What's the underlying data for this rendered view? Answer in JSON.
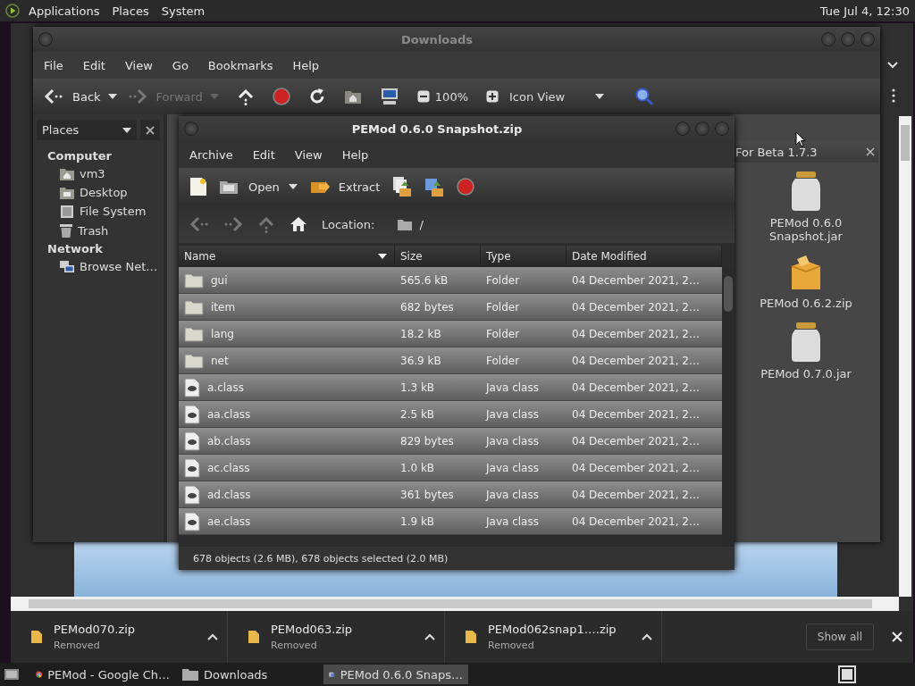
{
  "top_panel": {
    "menus": [
      "Applications",
      "Places",
      "System"
    ],
    "clock": "Tue Jul 4, 12:30"
  },
  "file_manager": {
    "title": "Downloads",
    "menu": [
      "File",
      "Edit",
      "View",
      "Go",
      "Bookmarks",
      "Help"
    ],
    "toolbar": {
      "back": {
        "label": "Back",
        "disabled": false
      },
      "forward": {
        "label": "Forward",
        "disabled": true
      },
      "zoom": "100%",
      "view": "Icon View"
    },
    "sidebar": {
      "title": "Places",
      "sections": [
        {
          "heading": "Computer",
          "items": [
            {
              "label": "vm3",
              "kind": "home"
            },
            {
              "label": "Desktop",
              "kind": "desktop"
            },
            {
              "label": "File System",
              "kind": "drive"
            },
            {
              "label": "Trash",
              "kind": "trash"
            }
          ]
        },
        {
          "heading": "Network",
          "items": [
            {
              "label": "Browse Net…",
              "kind": "network"
            }
          ]
        }
      ]
    },
    "tab": "For Beta 1.7.3",
    "files": [
      {
        "name": "PEMod 0.6.0 Snapshot.jar",
        "kind": "jar"
      },
      {
        "name": "PEMod 0.6.2.zip",
        "kind": "zip"
      },
      {
        "name": "PEMod 0.7.0.jar",
        "kind": "jar"
      }
    ]
  },
  "archive_manager": {
    "title": "PEMod 0.6.0 Snapshot.zip",
    "menu": [
      "Archive",
      "Edit",
      "View",
      "Help"
    ],
    "toolbar": {
      "open": "Open",
      "extract": "Extract"
    },
    "location_label": "Location:",
    "location": "/",
    "columns": [
      "Name",
      "Size",
      "Type",
      "Date Modified"
    ],
    "rows": [
      {
        "kind": "folder",
        "name": "gui",
        "size": "565.6 kB",
        "type": "Folder",
        "date": "04 December 2021, 2…",
        "selected": true
      },
      {
        "kind": "folder",
        "name": "item",
        "size": "682 bytes",
        "type": "Folder",
        "date": "04 December 2021, 2…",
        "selected": true
      },
      {
        "kind": "folder",
        "name": "lang",
        "size": "18.2 kB",
        "type": "Folder",
        "date": "04 December 2021, 2…",
        "selected": true
      },
      {
        "kind": "folder",
        "name": "net",
        "size": "36.9 kB",
        "type": "Folder",
        "date": "04 December 2021, 2…",
        "selected": true
      },
      {
        "kind": "class",
        "name": "a.class",
        "size": "1.3 kB",
        "type": "Java class",
        "date": "04 December 2021, 2…",
        "selected": true
      },
      {
        "kind": "class",
        "name": "aa.class",
        "size": "2.5 kB",
        "type": "Java class",
        "date": "04 December 2021, 2…",
        "selected": true
      },
      {
        "kind": "class",
        "name": "ab.class",
        "size": "829 bytes",
        "type": "Java class",
        "date": "04 December 2021, 2…",
        "selected": true
      },
      {
        "kind": "class",
        "name": "ac.class",
        "size": "1.0 kB",
        "type": "Java class",
        "date": "04 December 2021, 2…",
        "selected": true
      },
      {
        "kind": "class",
        "name": "ad.class",
        "size": "361 bytes",
        "type": "Java class",
        "date": "04 December 2021, 2…",
        "selected": true
      },
      {
        "kind": "class",
        "name": "ae.class",
        "size": "1.9 kB",
        "type": "Java class",
        "date": "04 December 2021, 2…",
        "selected": true
      }
    ],
    "status": "678 objects (2.6 MB), 678 objects selected (2.0 MB)"
  },
  "browser": {
    "downloads": [
      {
        "name": "PEMod070.zip",
        "status": "Removed"
      },
      {
        "name": "PEMod063.zip",
        "status": "Removed"
      },
      {
        "name": "PEMod062snap1….zip",
        "status": "Removed"
      }
    ],
    "show_all": "Show all"
  },
  "taskbar": {
    "tasks": [
      {
        "label": "PEMod - Google Ch…",
        "kind": "browser",
        "selected": false
      },
      {
        "label": "Downloads",
        "kind": "folder",
        "selected": false
      },
      {
        "label": "PEMod 0.6.0 Snaps…",
        "kind": "archive",
        "selected": true
      }
    ]
  }
}
